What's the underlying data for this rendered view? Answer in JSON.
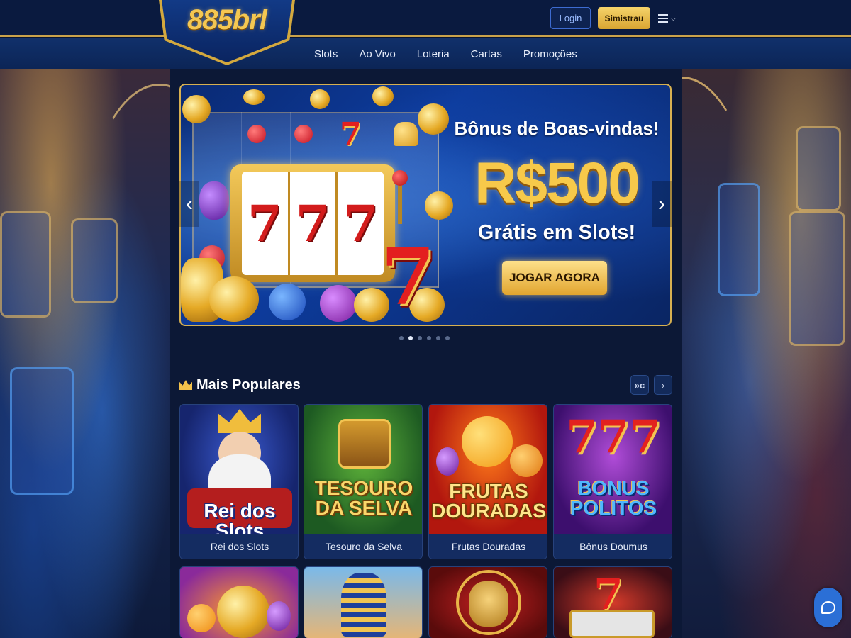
{
  "header": {
    "logo_text": "885brl",
    "login_label": "Login",
    "signup_label": "Simistrau"
  },
  "nav": {
    "items": [
      {
        "label": "Slots"
      },
      {
        "label": "Ao Vivo"
      },
      {
        "label": "Loteria"
      },
      {
        "label": "Cartas"
      },
      {
        "label": "Promoções"
      }
    ]
  },
  "banner": {
    "title": "Bônus de Boas-vindas!",
    "amount": "R$500",
    "subtitle": "Grátis em Slots!",
    "cta_label": "JOGAR AGORA",
    "reel_symbols": [
      "7",
      "7",
      "7"
    ],
    "slide_count": 6,
    "active_slide": 2
  },
  "popular": {
    "title": "Mais Populares",
    "prev_icon_text": "»c",
    "games": [
      {
        "name": "Rei dos Slots",
        "art_text": "Rei dos Slots"
      },
      {
        "name": "Tesouro da Selva",
        "art_text": "TESOURO DA SELVA"
      },
      {
        "name": "Frutas Douradas",
        "art_text": "FRUTAS DOURADAS"
      },
      {
        "name": "Bônus Doumus",
        "art_text": "BONUS POLITOS",
        "art_number": "777"
      }
    ]
  },
  "colors": {
    "accent_gold": "#f2c14b",
    "nav_blue": "#0c2556",
    "page_bg": "#0c1836",
    "chat_blue": "#2b6fd6"
  },
  "icons": {
    "menu": "hamburger-icon",
    "chevron": "chevron-down-icon",
    "arrow_left": "chevron-left-icon",
    "arrow_right": "chevron-right-icon",
    "crown": "crown-icon",
    "chat": "chat-icon"
  }
}
